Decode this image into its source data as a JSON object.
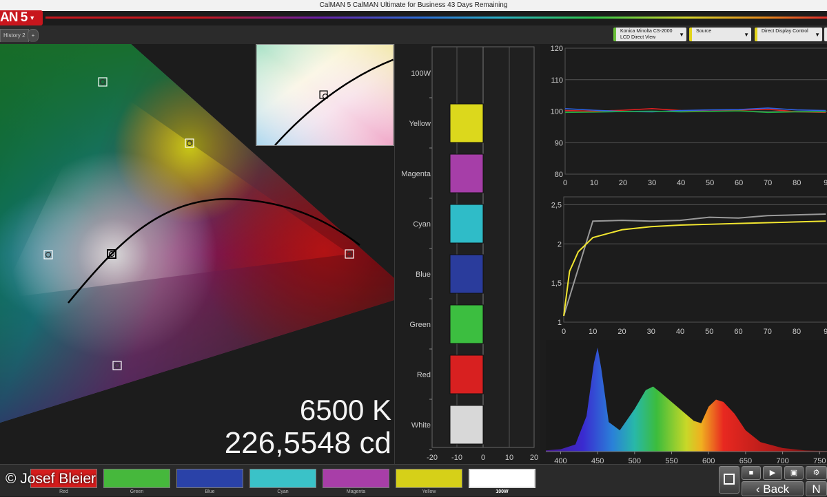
{
  "window": {
    "title": "CalMAN 5 CalMAN Ultimate for Business 43 Days Remaining"
  },
  "app": {
    "logo": "AN 5"
  },
  "tabs": [
    {
      "label": "History 2"
    },
    {
      "label": "+"
    }
  ],
  "devices": {
    "meter": {
      "line1": "Konica Minolta CS-2000",
      "line2": "LCD Direct View"
    },
    "source": {
      "label": "Source"
    },
    "display": {
      "label": "Direct Display Control"
    }
  },
  "readout": {
    "color_temp": "6500 K",
    "luminance": "226,5548 cd"
  },
  "bar_chart": {
    "categories": [
      "100W",
      "Yellow",
      "Magenta",
      "Cyan",
      "Blue",
      "Green",
      "Red",
      "White"
    ],
    "x_ticks": [
      "-20",
      "-10",
      "0",
      "10",
      "20"
    ],
    "swatch_colors": [
      "#dcd81c",
      "#a63ea8",
      "#2fbcc8",
      "#2a3c9c",
      "#3cbe40",
      "#d82020",
      "#d8d8d8"
    ]
  },
  "chart_data": [
    {
      "type": "line",
      "x": [
        0,
        10,
        20,
        30,
        40,
        50,
        60,
        70,
        80,
        90
      ],
      "x_ticks": [
        "0",
        "10",
        "20",
        "30",
        "40",
        "50",
        "60",
        "70",
        "80",
        "9"
      ],
      "y_ticks": [
        "80",
        "90",
        "100",
        "110",
        "120"
      ],
      "ylim": [
        80,
        120
      ],
      "series": [
        {
          "color": "#e02020",
          "values": [
            100.2,
            100,
            100.3,
            100.8,
            100.2,
            100,
            100.3,
            100.6,
            99.8,
            99.6
          ]
        },
        {
          "color": "#3060e0",
          "values": [
            100.8,
            100.3,
            99.9,
            99.8,
            100.2,
            100.4,
            100.5,
            101,
            100.4,
            100.2
          ]
        },
        {
          "color": "#20b040",
          "values": [
            99.6,
            99.7,
            99.9,
            100,
            99.8,
            99.9,
            100.1,
            99.6,
            99.8,
            99.8
          ]
        }
      ]
    },
    {
      "type": "line",
      "x_ticks": [
        "0",
        "10",
        "20",
        "30",
        "40",
        "50",
        "60",
        "70",
        "80",
        "9"
      ],
      "y_ticks": [
        "1",
        "1,5",
        "2",
        "2,5"
      ],
      "ylim": [
        1,
        2.6
      ],
      "series": [
        {
          "color": "#9a9a9a",
          "x": [
            0,
            10,
            20,
            30,
            40,
            50,
            60,
            70,
            80,
            90
          ],
          "values": [
            1.08,
            2.29,
            2.3,
            2.29,
            2.3,
            2.34,
            2.33,
            2.36,
            2.37,
            2.38
          ]
        },
        {
          "color": "#f2e630",
          "x": [
            0,
            2,
            5,
            10,
            20,
            30,
            40,
            50,
            60,
            70,
            80,
            90
          ],
          "values": [
            1.08,
            1.65,
            1.9,
            2.08,
            2.18,
            2.22,
            2.24,
            2.25,
            2.26,
            2.27,
            2.28,
            2.29
          ]
        }
      ]
    },
    {
      "type": "area",
      "x_ticks": [
        "400",
        "450",
        "500",
        "550",
        "600",
        "650",
        "700",
        "750"
      ],
      "xlim": [
        380,
        760
      ],
      "x": [
        380,
        400,
        420,
        435,
        445,
        450,
        455,
        465,
        480,
        500,
        515,
        525,
        535,
        550,
        565,
        580,
        590,
        600,
        610,
        620,
        635,
        650,
        670,
        700,
        730,
        760
      ],
      "values": [
        0.01,
        0.02,
        0.06,
        0.3,
        0.75,
        0.88,
        0.7,
        0.25,
        0.18,
        0.36,
        0.52,
        0.55,
        0.5,
        0.42,
        0.34,
        0.26,
        0.24,
        0.38,
        0.44,
        0.42,
        0.32,
        0.18,
        0.08,
        0.03,
        0.01,
        0.005
      ]
    }
  ],
  "swatches": [
    {
      "label": "Red",
      "color": "#d41c1c"
    },
    {
      "label": "Green",
      "color": "#46b83c"
    },
    {
      "label": "Blue",
      "color": "#2a42a8"
    },
    {
      "label": "Cyan",
      "color": "#3ac2c8"
    },
    {
      "label": "Magenta",
      "color": "#a83ea8"
    },
    {
      "label": "Yellow",
      "color": "#d6d018"
    },
    {
      "label": "100W",
      "color": "#ffffff"
    }
  ],
  "credit": "© Josef Bleier",
  "controls": {
    "back": "Back",
    "next": "N"
  }
}
